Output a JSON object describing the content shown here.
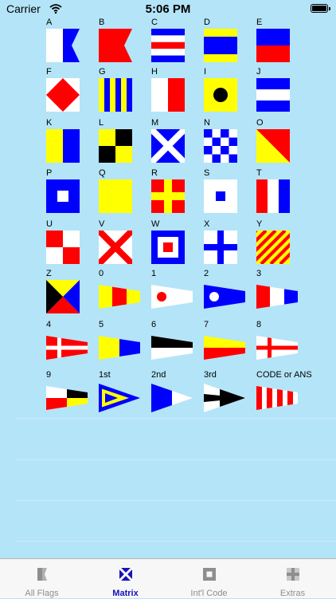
{
  "status_bar": {
    "carrier": "Carrier",
    "time": "5:06 PM",
    "battery_level": 1.0
  },
  "flags": [
    {
      "label": "A",
      "icon": "flag-a-icon"
    },
    {
      "label": "B",
      "icon": "flag-b-icon"
    },
    {
      "label": "C",
      "icon": "flag-c-icon"
    },
    {
      "label": "D",
      "icon": "flag-d-icon"
    },
    {
      "label": "E",
      "icon": "flag-e-icon"
    },
    {
      "label": "F",
      "icon": "flag-f-icon"
    },
    {
      "label": "G",
      "icon": "flag-g-icon"
    },
    {
      "label": "H",
      "icon": "flag-h-icon"
    },
    {
      "label": "I",
      "icon": "flag-i-icon"
    },
    {
      "label": "J",
      "icon": "flag-j-icon"
    },
    {
      "label": "K",
      "icon": "flag-k-icon"
    },
    {
      "label": "L",
      "icon": "flag-l-icon"
    },
    {
      "label": "M",
      "icon": "flag-m-icon"
    },
    {
      "label": "N",
      "icon": "flag-n-icon"
    },
    {
      "label": "O",
      "icon": "flag-o-icon"
    },
    {
      "label": "P",
      "icon": "flag-p-icon"
    },
    {
      "label": "Q",
      "icon": "flag-q-icon"
    },
    {
      "label": "R",
      "icon": "flag-r-icon"
    },
    {
      "label": "S",
      "icon": "flag-s-icon"
    },
    {
      "label": "T",
      "icon": "flag-t-icon"
    },
    {
      "label": "U",
      "icon": "flag-u-icon"
    },
    {
      "label": "V",
      "icon": "flag-v-icon"
    },
    {
      "label": "W",
      "icon": "flag-w-icon"
    },
    {
      "label": "X",
      "icon": "flag-x-icon"
    },
    {
      "label": "Y",
      "icon": "flag-y-icon"
    },
    {
      "label": "Z",
      "icon": "flag-z-icon"
    },
    {
      "label": "0",
      "icon": "pennant-0-icon"
    },
    {
      "label": "1",
      "icon": "pennant-1-icon"
    },
    {
      "label": "2",
      "icon": "pennant-2-icon"
    },
    {
      "label": "3",
      "icon": "pennant-3-icon"
    },
    {
      "label": "4",
      "icon": "pennant-4-icon"
    },
    {
      "label": "5",
      "icon": "pennant-5-icon"
    },
    {
      "label": "6",
      "icon": "pennant-6-icon"
    },
    {
      "label": "7",
      "icon": "pennant-7-icon"
    },
    {
      "label": "8",
      "icon": "pennant-8-icon"
    },
    {
      "label": "9",
      "icon": "pennant-9-icon"
    },
    {
      "label": "1st",
      "icon": "substitute-1st-icon"
    },
    {
      "label": "2nd",
      "icon": "substitute-2nd-icon"
    },
    {
      "label": "3rd",
      "icon": "substitute-3rd-icon"
    },
    {
      "label": "CODE or ANS",
      "icon": "code-answer-pennant-icon"
    }
  ],
  "tabs": [
    {
      "label": "All Flags",
      "icon": "all-flags-icon",
      "active": false
    },
    {
      "label": "Matrix",
      "icon": "matrix-icon",
      "active": true
    },
    {
      "label": "Int'l Code",
      "icon": "intl-code-icon",
      "active": false
    },
    {
      "label": "Extras",
      "icon": "extras-icon",
      "active": false
    }
  ],
  "colors": {
    "background": "#b4e4f7",
    "flag_red": "#ff0000",
    "flag_blue": "#0000ff",
    "flag_yellow": "#ffff00",
    "flag_black": "#000000",
    "active_tab": "#1a12b8",
    "inactive_tab": "#8e8e8e"
  }
}
